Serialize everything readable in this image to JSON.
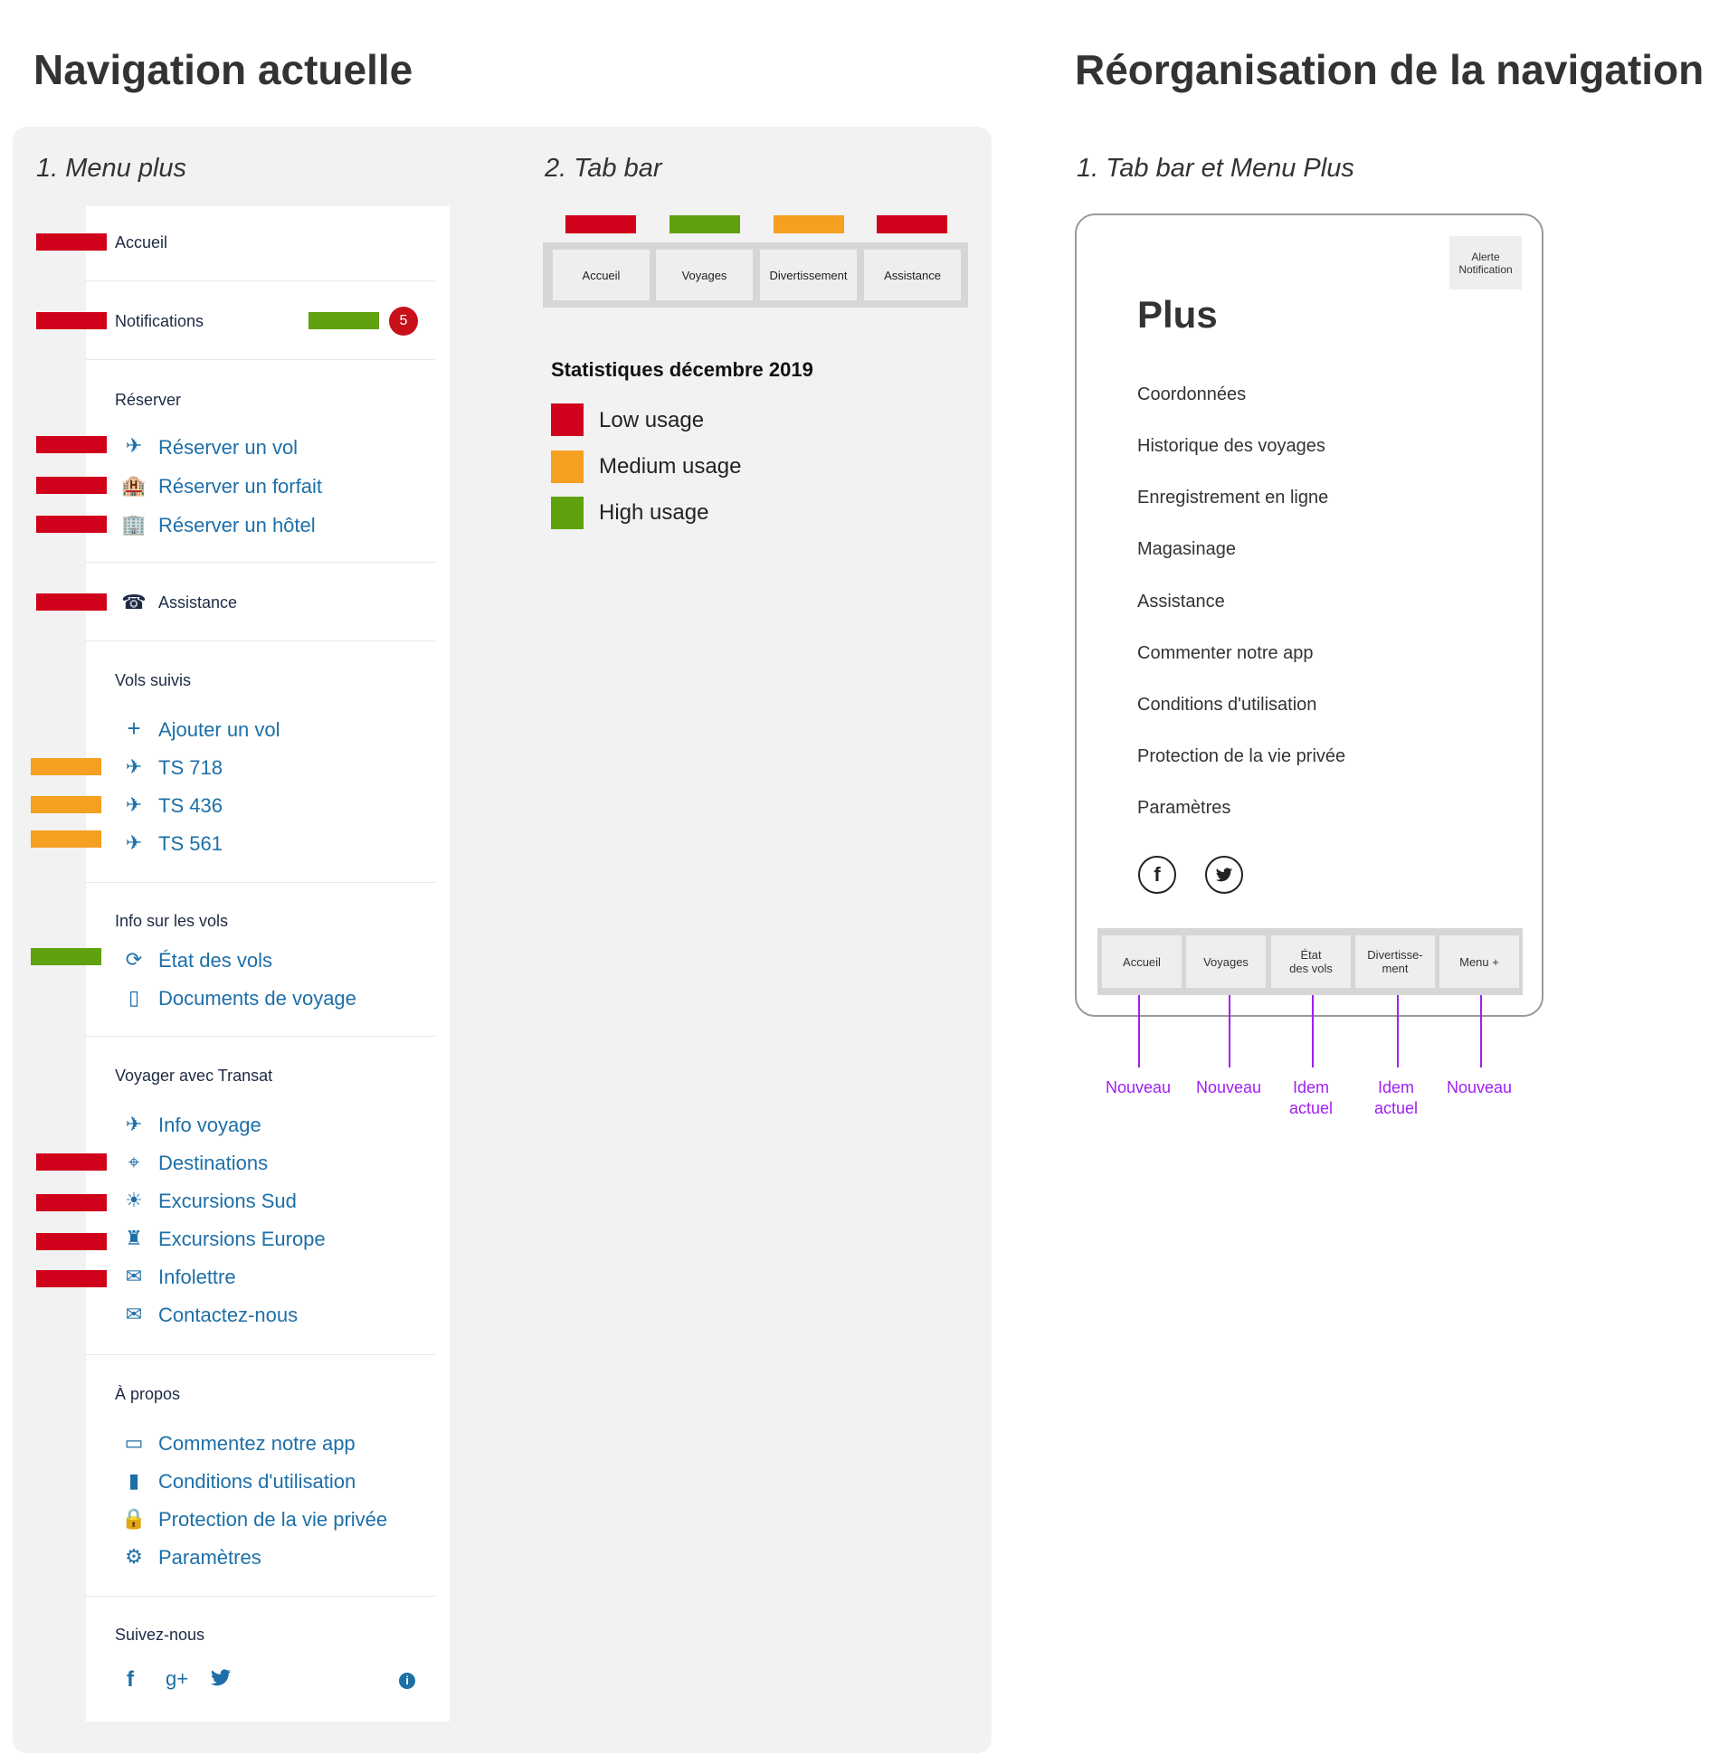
{
  "titles": {
    "current": "Navigation actuelle",
    "reorg": "Réorganisation de la navigation"
  },
  "subtitles": {
    "menu_plus": "1. Menu plus",
    "tab_bar": "2. Tab bar",
    "tab_and_plus": "1. Tab bar et Menu Plus"
  },
  "colors": {
    "low": "#d0021b",
    "medium": "#f5a020",
    "high": "#5fa10f",
    "annotation": "#a020f0",
    "link": "#1d6fa8"
  },
  "menu": {
    "top": {
      "accueil": "Accueil",
      "notifications": "Notifications",
      "badge": "5",
      "assistance": "Assistance"
    },
    "sections": {
      "reserver": "Réserver",
      "vols_suivis": "Vols suivis",
      "info_vols": "Info sur les vols",
      "voyager": "Voyager avec Transat",
      "apropos": "À propos",
      "suivez": "Suivez-nous"
    },
    "reserver": [
      "Réserver un vol",
      "Réserver un forfait",
      "Réserver un hôtel"
    ],
    "vols_suivis": [
      "Ajouter un vol",
      "TS 718",
      "TS 436",
      "TS 561"
    ],
    "info_vols": [
      "État des vols",
      "Documents de voyage"
    ],
    "voyager": [
      "Info voyage",
      "Destinations",
      "Excursions Sud",
      "Excursions Europe",
      "Infolettre",
      "Contactez-nous"
    ],
    "apropos": [
      "Commentez notre app",
      "Conditions d'utilisation",
      "Protection de la vie privée",
      "Paramètres"
    ],
    "usage": {
      "accueil": "low",
      "notifications": "low",
      "notifications_badge_bar": "high",
      "reserver_vol": "low",
      "reserver_forfait": "low",
      "reserver_hotel": "low",
      "assistance": "low",
      "ts718": "medium",
      "ts436": "medium",
      "ts561": "medium",
      "etat_vols": "high",
      "destinations": "low",
      "excursions_sud": "low",
      "excursions_europe": "low",
      "infolettre": "low"
    }
  },
  "tabbar_current": {
    "tabs": [
      "Accueil",
      "Voyages",
      "Divertissement",
      "Assistance"
    ],
    "usage": [
      "low",
      "high",
      "medium",
      "low"
    ]
  },
  "stats": {
    "title": "Statistiques décembre 2019",
    "legend": [
      "Low usage",
      "Medium usage",
      "High usage"
    ]
  },
  "phone": {
    "alert": "Alerte Notification",
    "title": "Plus",
    "items": [
      "Coordonnées",
      "Historique des voyages",
      "Enregistrement en ligne",
      "Magasinage",
      "Assistance",
      "Commenter notre app",
      "Conditions d'utilisation",
      "Protection de la vie privée",
      "Paramètres"
    ],
    "tabs": [
      {
        "line1": "Accueil",
        "line2": ""
      },
      {
        "line1": "Voyages",
        "line2": ""
      },
      {
        "line1": "État",
        "line2": "des vols"
      },
      {
        "line1": "Divertisse-",
        "line2": "ment"
      },
      {
        "line1": "Menu +",
        "line2": ""
      }
    ],
    "annotations": [
      {
        "line1": "Nouveau",
        "line2": ""
      },
      {
        "line1": "Nouveau",
        "line2": ""
      },
      {
        "line1": "Idem",
        "line2": "actuel"
      },
      {
        "line1": "Idem",
        "line2": "actuel"
      },
      {
        "line1": "Nouveau",
        "line2": ""
      }
    ]
  }
}
